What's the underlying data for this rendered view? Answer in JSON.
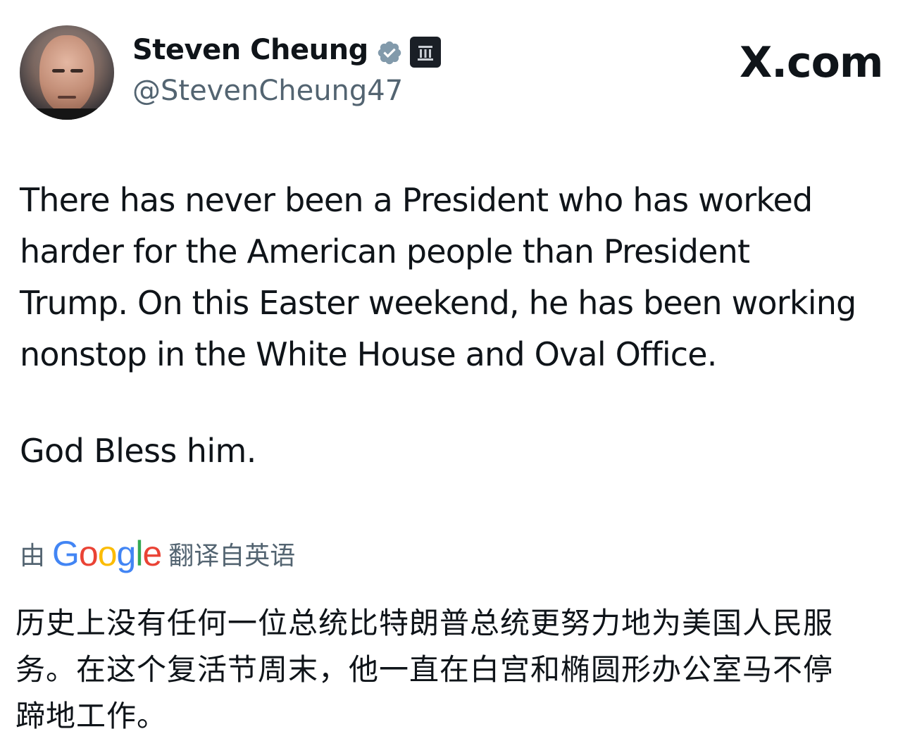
{
  "author": {
    "name": "Steven Cheung",
    "handle": "@StevenCheung47",
    "avatar_icon": "user-avatar-photo",
    "verified_icon": "verified-badge-icon",
    "affiliation_icon": "government-affiliation-icon",
    "verified_color": "#829aab"
  },
  "brand": {
    "site_label": "X.com"
  },
  "tweet": {
    "text": "There has never been a President who has worked\nharder for the American people than President\nTrump. On this Easter weekend, he has been working\nnonstop in the White House and Oval Office.",
    "closing": "God Bless him."
  },
  "translation": {
    "prefix": "由",
    "provider_letters": [
      "G",
      "o",
      "o",
      "g",
      "l",
      "e"
    ],
    "suffix": "翻译自英语",
    "text": "历史上没有任何一位总统比特朗普总统更努力地为美国人民服\n务。在这个复活节周末，他一直在白宫和椭圆形办公室马不停\n蹄地工作。"
  }
}
